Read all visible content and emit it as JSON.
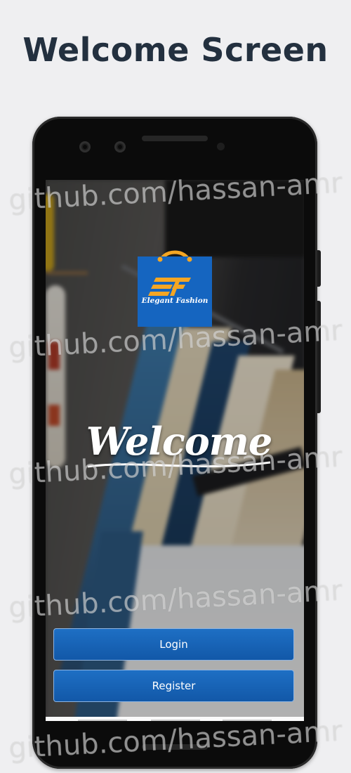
{
  "page": {
    "title": "Welcome Screen"
  },
  "app": {
    "logo_text": "Elegant Fashion",
    "logo_letters": "EF",
    "welcome_text": "Welcome",
    "login_label": "Login",
    "register_label": "Register"
  },
  "watermark": {
    "text": "github.com/hassan-amr"
  },
  "colors": {
    "background": "#efeff1",
    "title": "#23303f",
    "button": "#1565c0",
    "logo_bag": "#1565c0",
    "logo_accent": "#f5a623"
  },
  "icons": {
    "logo": "shopping-bag-logo-icon",
    "camera": "front-camera-icon"
  }
}
